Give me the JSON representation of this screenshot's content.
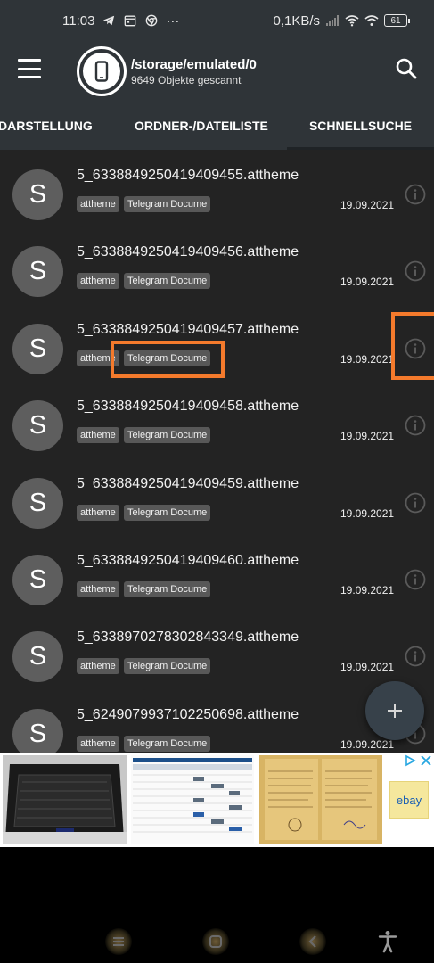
{
  "status_bar": {
    "time": "11:03",
    "extra": "···",
    "speed": "0,1KB/s",
    "battery": "61"
  },
  "app_bar": {
    "path": "/storage/emulated/0",
    "subtitle": "9649 Objekte gescannt"
  },
  "tabs": [
    {
      "label": "DARSTELLUNG"
    },
    {
      "label": "ORDNER-/DATEILISTE"
    },
    {
      "label": "SCHNELLSUCHE"
    }
  ],
  "files": [
    {
      "avatar": "S",
      "name": "5_6338849250419409455.attheme",
      "tag1": "attheme",
      "tag2": "Telegram Docume",
      "date": "19.09.2021"
    },
    {
      "avatar": "S",
      "name": "5_6338849250419409456.attheme",
      "tag1": "attheme",
      "tag2": "Telegram Docume",
      "date": "19.09.2021"
    },
    {
      "avatar": "S",
      "name": "5_6338849250419409457.attheme",
      "tag1": "attheme",
      "tag2": "Telegram Docume",
      "date": "19.09.2021"
    },
    {
      "avatar": "S",
      "name": "5_6338849250419409458.attheme",
      "tag1": "attheme",
      "tag2": "Telegram Docume",
      "date": "19.09.2021"
    },
    {
      "avatar": "S",
      "name": "5_6338849250419409459.attheme",
      "tag1": "attheme",
      "tag2": "Telegram Docume",
      "date": "19.09.2021"
    },
    {
      "avatar": "S",
      "name": "5_6338849250419409460.attheme",
      "tag1": "attheme",
      "tag2": "Telegram Docume",
      "date": "19.09.2021"
    },
    {
      "avatar": "S",
      "name": "5_6338970278302843349.attheme",
      "tag1": "attheme",
      "tag2": "Telegram Docume",
      "date": "19.09.2021"
    },
    {
      "avatar": "S",
      "name": "5_6249079937102250698.attheme",
      "tag1": "attheme",
      "tag2": "Telegram Docume",
      "date": "19.09.2021"
    }
  ],
  "ad": {
    "ebay_label": "ebay"
  },
  "colors": {
    "app_bar": "#2f3438",
    "list_bg": "#232323",
    "highlight": "#f47a2c",
    "avatar": "#5e5e5e"
  }
}
